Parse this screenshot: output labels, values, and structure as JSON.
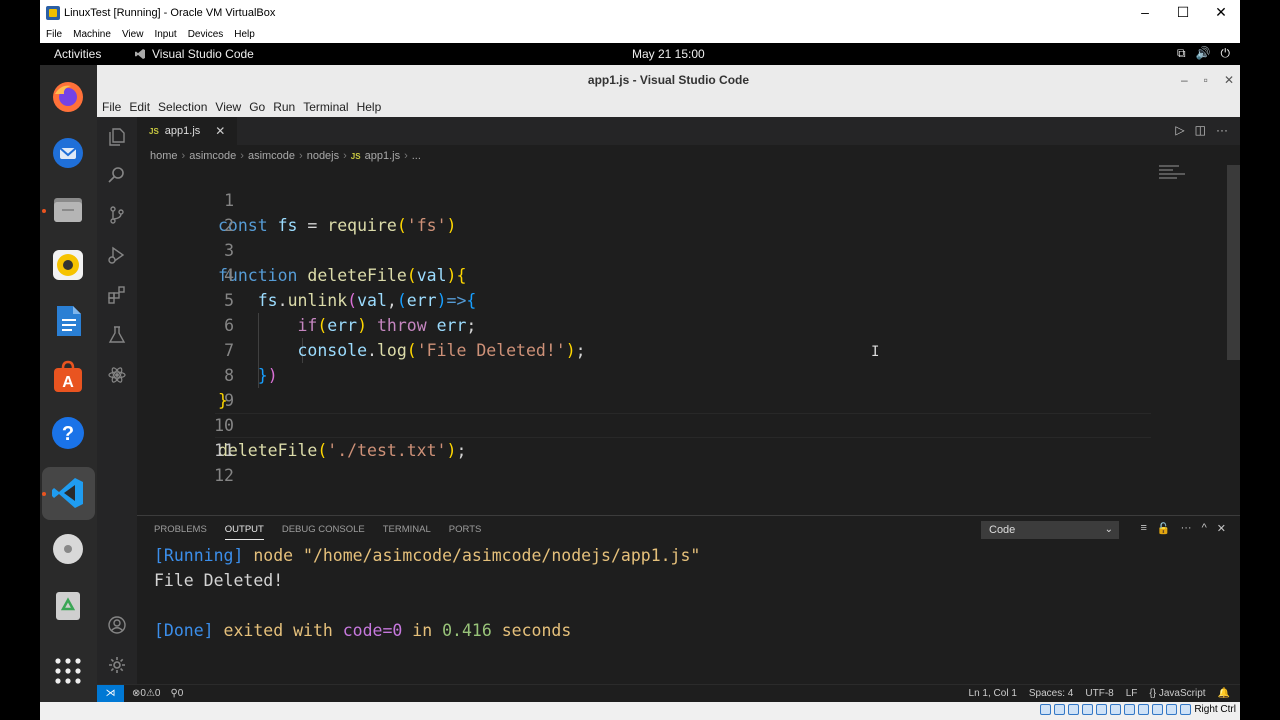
{
  "host_window": {
    "title": "LinuxTest [Running] - Oracle VM VirtualBox",
    "menu": [
      "File",
      "Machine",
      "View",
      "Input",
      "Devices",
      "Help"
    ],
    "host_key_label": "Right Ctrl"
  },
  "gnome_bar": {
    "activities": "Activities",
    "app_name": "Visual Studio Code",
    "clock": "May 21  15:00"
  },
  "dock": {
    "items": [
      "firefox",
      "thunderbird",
      "files",
      "rhythmbox",
      "writer",
      "software",
      "help",
      "vscode",
      "dvd",
      "trash",
      "app-grid"
    ],
    "active": "vscode"
  },
  "vscode": {
    "window_title": "app1.js - Visual Studio Code",
    "menu": [
      "File",
      "Edit",
      "Selection",
      "View",
      "Go",
      "Run",
      "Terminal",
      "Help"
    ],
    "tab": {
      "badge": "JS",
      "label": "app1.js",
      "close": "✕"
    },
    "breadcrumb": [
      "home",
      "asimcode",
      "asimcode",
      "nodejs",
      "app1.js",
      "..."
    ],
    "line_numbers": [
      "1",
      "2",
      "3",
      "4",
      "5",
      "6",
      "7",
      "8",
      "9",
      "10",
      "11",
      "12"
    ],
    "current_line": "11",
    "panel": {
      "tabs": [
        "PROBLEMS",
        "OUTPUT",
        "DEBUG CONSOLE",
        "TERMINAL",
        "PORTS"
      ],
      "active_tab": "OUTPUT",
      "channel": "Code",
      "output": {
        "line1_status": "[Running]",
        "line1_cmd": " node \"/home/asimcode/asimcode/nodejs/app1.js\"",
        "line2": "File Deleted!",
        "line3_status": "[Done]",
        "line3_a": " exited with ",
        "line3_code": "code=0",
        "line3_b": " in ",
        "line3_time": "0.416",
        "line3_c": " seconds"
      }
    },
    "status_bar": {
      "problems": "⊗0⚠0",
      "ports": "⚲0",
      "position": "Ln 1, Col 1",
      "spaces": "Spaces: 4",
      "encoding": "UTF-8",
      "eol": "LF",
      "language": "{} JavaScript"
    }
  },
  "colors": {
    "keyword": "#569cd6",
    "function": "#dcdcaa",
    "string": "#ce9178",
    "variable": "#9cdcfe",
    "accent": "#0078d4"
  }
}
